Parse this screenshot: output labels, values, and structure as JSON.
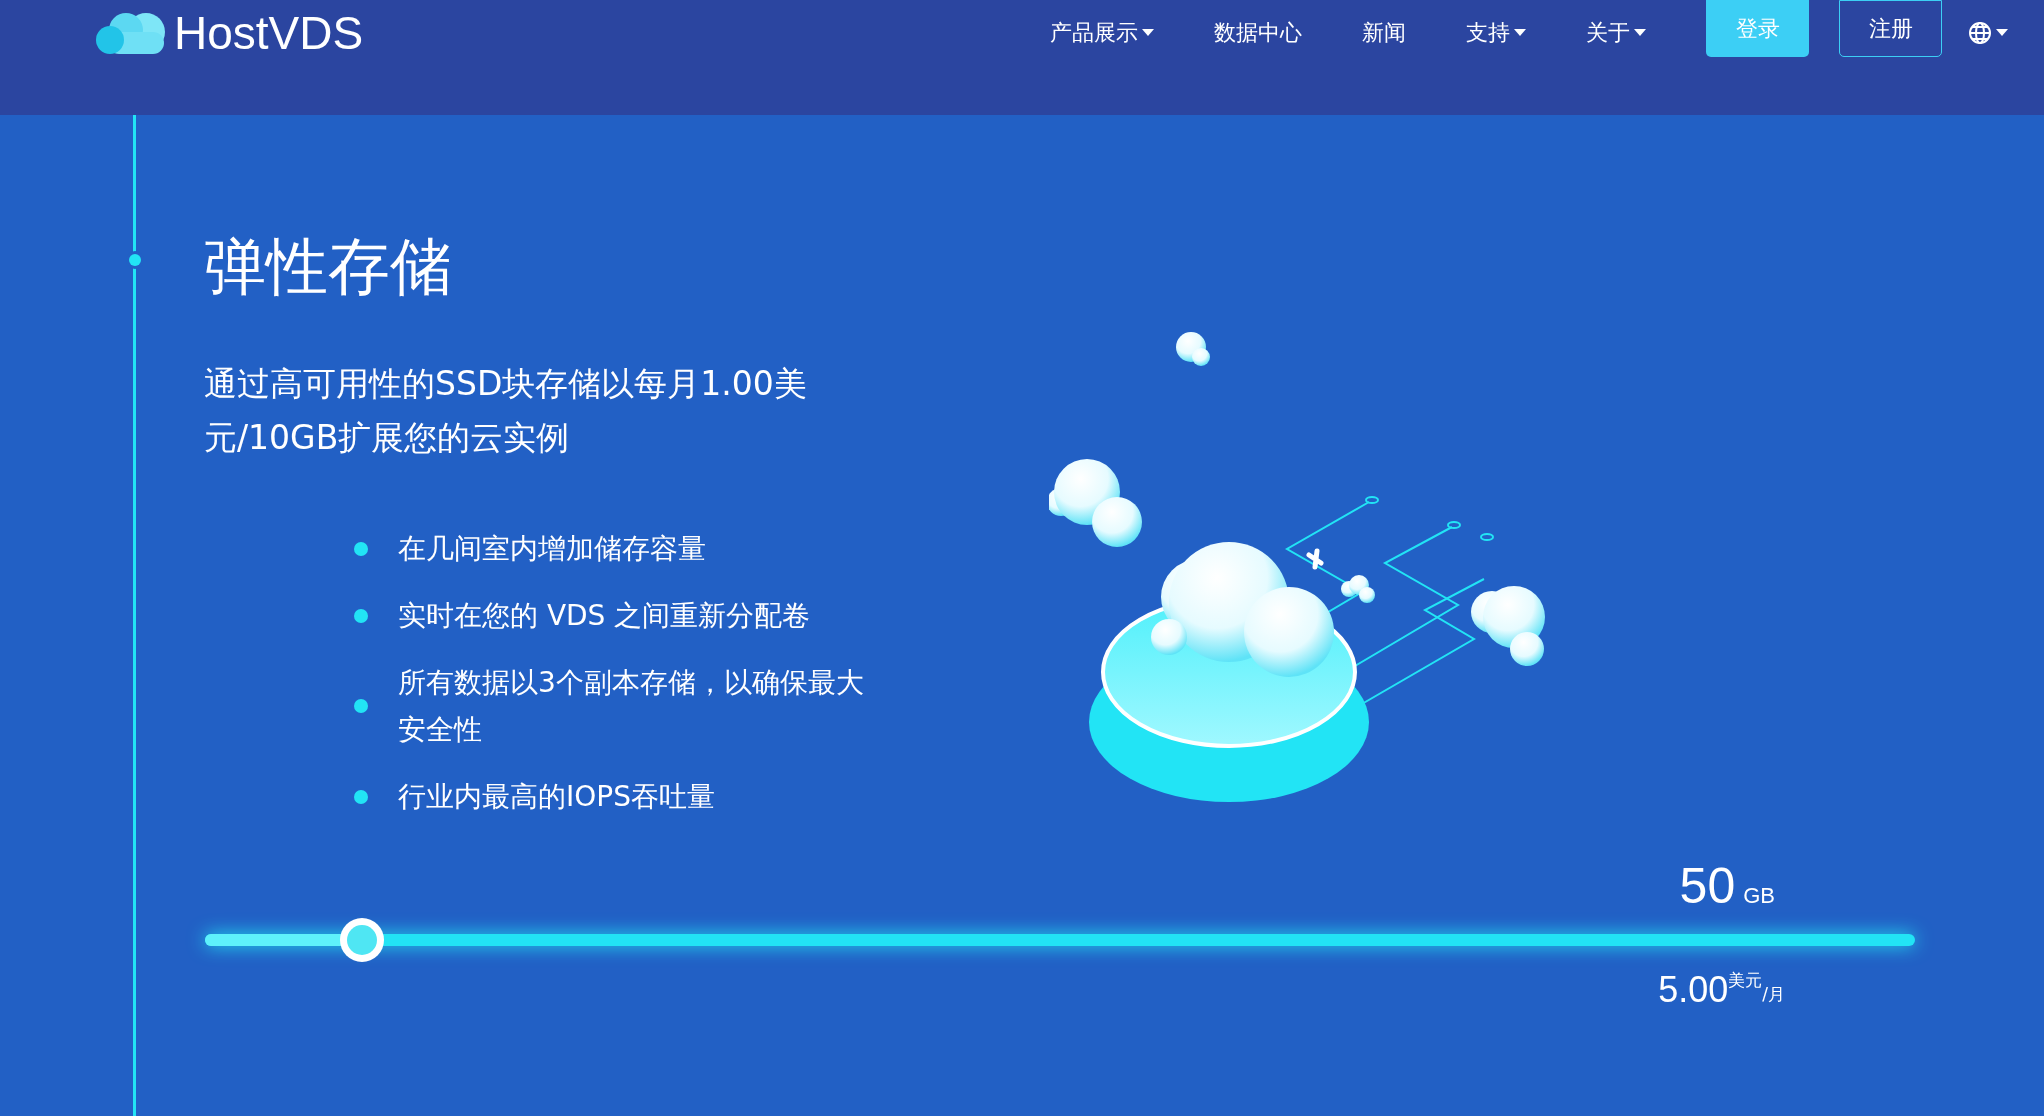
{
  "header": {
    "logo": "HostVDS",
    "nav": [
      {
        "label": "产品展示",
        "has_dropdown": true
      },
      {
        "label": "数据中心",
        "has_dropdown": false
      },
      {
        "label": "新闻",
        "has_dropdown": false
      },
      {
        "label": "支持",
        "has_dropdown": true
      },
      {
        "label": "关于",
        "has_dropdown": true
      }
    ],
    "buttons": [
      {
        "label": "登录",
        "kind": "filled"
      },
      {
        "label": "注册",
        "kind": "outline"
      }
    ]
  },
  "hero": {
    "title": "弹性存储",
    "subtitle": "通过高可用性的SSD块存储以每月1.00美元/10GB扩展您的云实例",
    "features": [
      "在几间室内增加储存容量",
      "实时在您的 VDS 之间重新分配卷",
      "所有数据以3个副本存储，以确保最大安全性",
      "行业内最高的IOPS吞吐量"
    ]
  },
  "storage_slider": {
    "level": 0.092,
    "amount": "50",
    "unit": "GB",
    "price": "5.00",
    "currency": "美元",
    "period": "/月"
  }
}
